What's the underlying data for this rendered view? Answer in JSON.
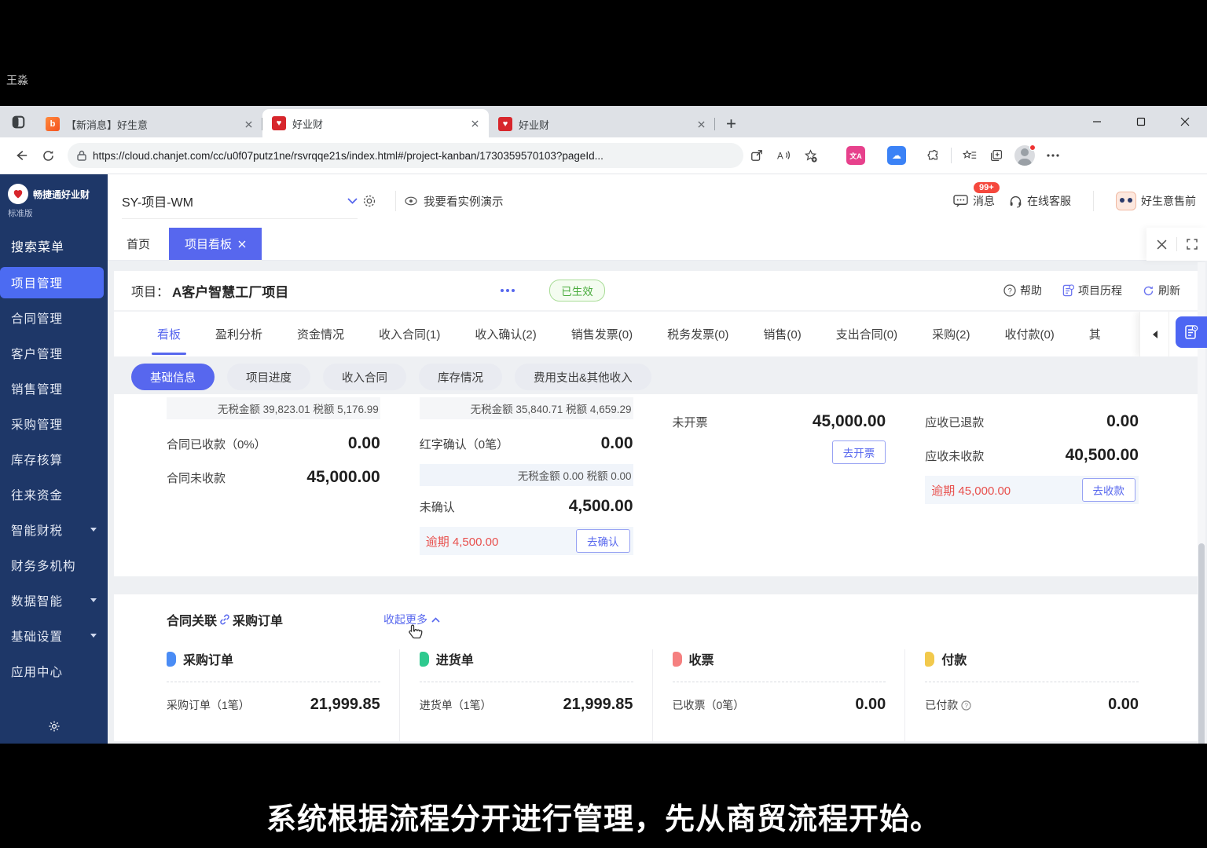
{
  "browser": {
    "tabs": [
      {
        "title": "【新消息】好生意"
      },
      {
        "title": "好业财"
      },
      {
        "title": "好业财"
      }
    ],
    "url": "https://cloud.chanjet.com/cc/u0f07putz1ne/rsvrqqe21s/index.html#/project-kanban/1730359570103?pageId..."
  },
  "header": {
    "logo_title": "畅捷通好业财",
    "logo_sub": "标准版",
    "org": "SY-项目-WM",
    "demo": "我要看实例演示",
    "messages": "消息",
    "messages_badge": "99+",
    "support": "在线客服",
    "presales": "好生意售前"
  },
  "sidebar": {
    "search": "搜索菜单",
    "items": [
      {
        "label": "项目管理"
      },
      {
        "label": "合同管理"
      },
      {
        "label": "客户管理"
      },
      {
        "label": "销售管理"
      },
      {
        "label": "采购管理"
      },
      {
        "label": "库存核算"
      },
      {
        "label": "往来资金"
      },
      {
        "label": "智能财税"
      },
      {
        "label": "财务多机构"
      },
      {
        "label": "数据智能"
      },
      {
        "label": "基础设置"
      },
      {
        "label": "应用中心"
      }
    ]
  },
  "workspace_tabs": {
    "home": "首页",
    "kanban": "项目看板"
  },
  "project": {
    "label": "项目：",
    "name": "A客户智慧工厂项目",
    "status": "已生效",
    "help": "帮助",
    "history": "项目历程",
    "refresh": "刷新"
  },
  "tabs": [
    "看板",
    "盈利分析",
    "资金情况",
    "收入合同(1)",
    "收入确认(2)",
    "销售发票(0)",
    "税务发票(0)",
    "销售(0)",
    "支出合同(0)",
    "采购(2)",
    "收付款(0)",
    "其"
  ],
  "subtabs": [
    "基础信息",
    "项目进度",
    "收入合同",
    "库存情况",
    "费用支出&其他收入"
  ],
  "stats": {
    "col1": {
      "tax": "无税金额 39,823.01 税额 5,176.99",
      "row1": {
        "label": "合同已收款（0%）",
        "value": "0.00"
      },
      "row2": {
        "label": "合同未收款",
        "value": "45,000.00"
      }
    },
    "col2": {
      "tax": "无税金额 35,840.71 税额 4,659.29",
      "row1": {
        "label": "红字确认（0笔）",
        "value": "0.00"
      },
      "tax2": "无税金额 0.00 税额 0.00",
      "row2": {
        "label": "未确认",
        "value": "4,500.00"
      },
      "overdue": {
        "label": "逾期 4,500.00",
        "button": "去确认"
      }
    },
    "col3": {
      "row1": {
        "label": "未开票",
        "value": "45,000.00"
      },
      "button": "去开票"
    },
    "col4": {
      "row1": {
        "label": "应收已退款",
        "value": "0.00"
      },
      "row2": {
        "label": "应收未收款",
        "value": "40,500.00"
      },
      "overdue": {
        "label": "逾期 45,000.00",
        "button": "去收款"
      }
    }
  },
  "purchase_section": {
    "title_a": "合同关联",
    "title_b": "采购订单",
    "collapse": "收起更多",
    "cards": [
      {
        "name": "采购订单",
        "label": "采购订单（1笔）",
        "value": "21,999.85",
        "color": "#4a8cf5"
      },
      {
        "name": "进货单",
        "label": "进货单（1笔）",
        "value": "21,999.85",
        "color": "#2ec98e"
      },
      {
        "name": "收票",
        "label": "已收票（0笔）",
        "value": "0.00",
        "color": "#f58080"
      },
      {
        "name": "付款",
        "label": "已付款",
        "value": "0.00",
        "color": "#f2c94c"
      }
    ]
  },
  "colors": {
    "accent": "#5767ee",
    "overdue_red": "#e8504d",
    "sidebar_navy": "#1e3768",
    "status_green": "#49ab3c"
  },
  "subtitle": "系统根据流程分开进行管理，先从商贸流程开始。",
  "watermark": "王淼"
}
